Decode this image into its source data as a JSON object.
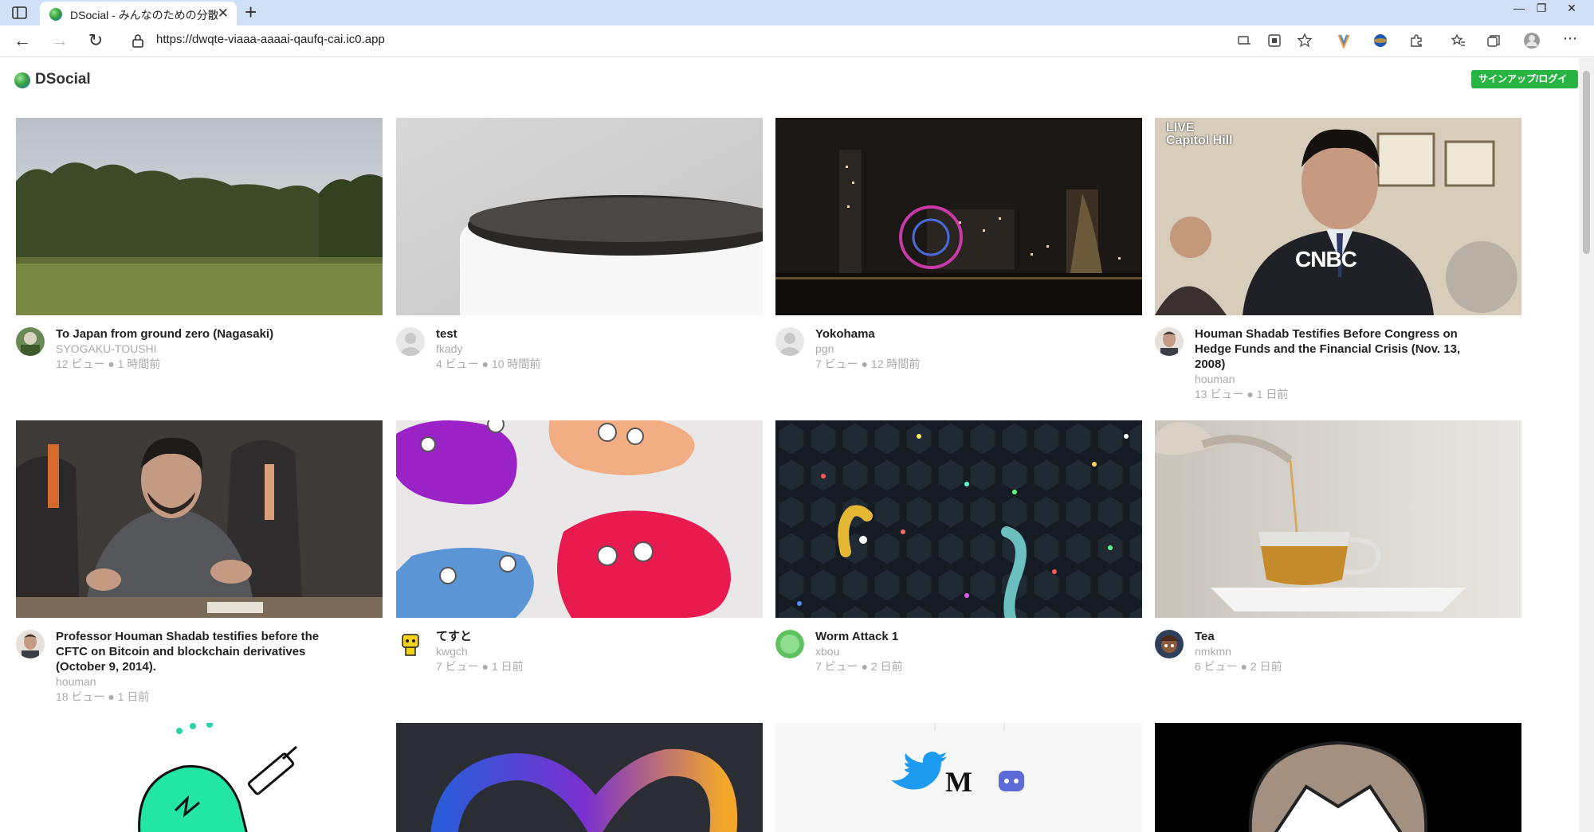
{
  "browser": {
    "tab_title": "DSocial - みんなのための分散ソーシャル",
    "url": "https://dwqte-viaaa-aaaai-qaufq-cai.ic0.app"
  },
  "header": {
    "brand": "DSocial",
    "signup_label": "サインアップ/ログイン"
  },
  "videos": [
    {
      "title": "To Japan from ground zero (Nagasaki)",
      "user": "SYOGAKU-TOUSHI",
      "stats": "12 ビュー ● 1 時間前"
    },
    {
      "title": "test",
      "user": "fkady",
      "stats": "4 ビュー ● 10 時間前"
    },
    {
      "title": "Yokohama",
      "user": "pgn",
      "stats": "7 ビュー ● 12 時間前"
    },
    {
      "title": "Houman Shadab Testifies Before Congress on Hedge Funds and the Financial Crisis (Nov. 13, 2008)",
      "user": "houman",
      "stats": "13 ビュー ● 1 日前"
    },
    {
      "title": "Professor Houman Shadab testifies before the CFTC on Bitcoin and blockchain derivatives (October 9, 2014).",
      "user": "houman",
      "stats": "18 ビュー ● 1 日前"
    },
    {
      "title": "てすと",
      "user": "kwgch",
      "stats": "7 ビュー ● 1 日前"
    },
    {
      "title": "Worm Attack 1",
      "user": "xbou",
      "stats": "7 ビュー ● 2 日前"
    },
    {
      "title": "Tea",
      "user": "nmkmn",
      "stats": "6 ビュー ● 2 日前"
    }
  ],
  "thumb_text": {
    "live": "LIVE",
    "location": "Capitol Hill",
    "network": "CNBC"
  }
}
